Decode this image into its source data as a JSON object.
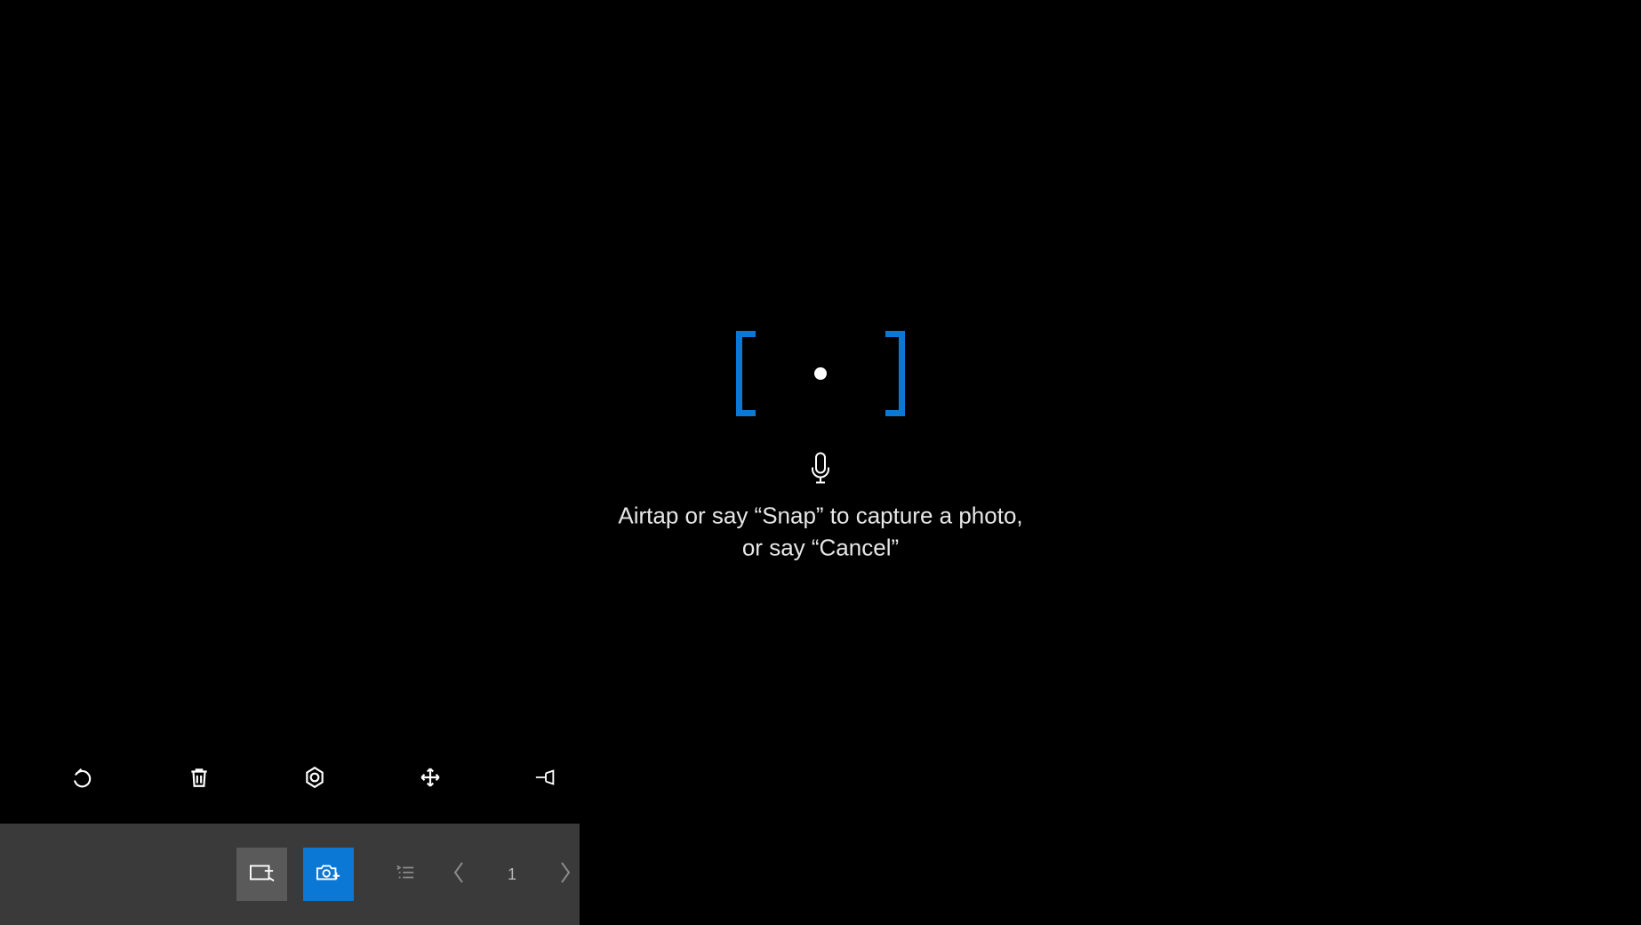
{
  "capture": {
    "instruction_line1": "Airtap or say “Snap” to capture a photo,",
    "instruction_line2": "or say “Cancel”"
  },
  "pager": {
    "current": "1"
  },
  "colors": {
    "accent": "#0a78d4",
    "dock_bg": "#3a3a3a",
    "dock_btn_gray": "#5a5a5a"
  },
  "icons": {
    "undo": "undo-icon",
    "trash": "trash-icon",
    "target": "target-icon",
    "move": "move-icon",
    "pin": "pin-icon",
    "mic": "microphone-icon",
    "annotate": "annotate-icon",
    "camera": "camera-icon",
    "list": "list-icon",
    "prev": "chevron-left-icon",
    "next": "chevron-right-icon"
  }
}
